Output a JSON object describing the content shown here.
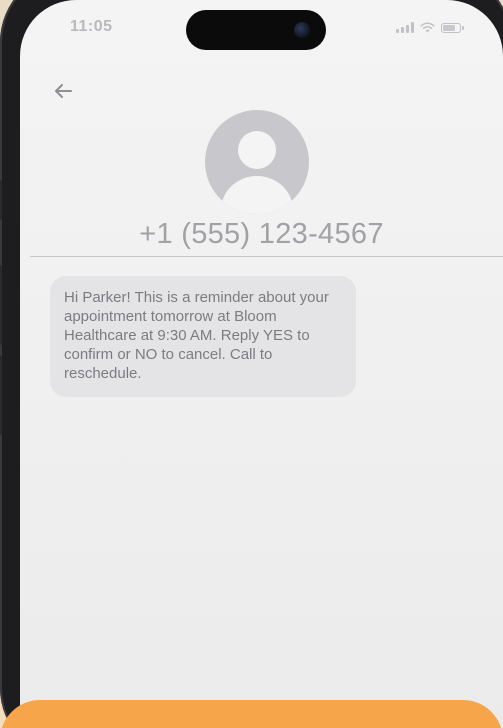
{
  "status_bar": {
    "time": "11:05",
    "wifi_icon": "wifi-icon",
    "signal_icon": "cellular-signal-icon",
    "battery_icon": "battery-icon"
  },
  "header": {
    "back_icon": "back-arrow-icon",
    "avatar_icon": "person-avatar-icon",
    "contact_number": "+1 (555) 123-4567"
  },
  "messages": [
    {
      "direction": "incoming",
      "text": "Hi Parker! This is a reminder about your appointment tomorrow at Bloom Healthcare at 9:30 AM. Reply YES to confirm or NO to cancel. Call to reschedule."
    }
  ],
  "colors": {
    "background": "#ecdcc4",
    "accent_band": "#f6a54a",
    "bubble": "#e4e4e6",
    "muted_text": "#a1a1a6"
  }
}
